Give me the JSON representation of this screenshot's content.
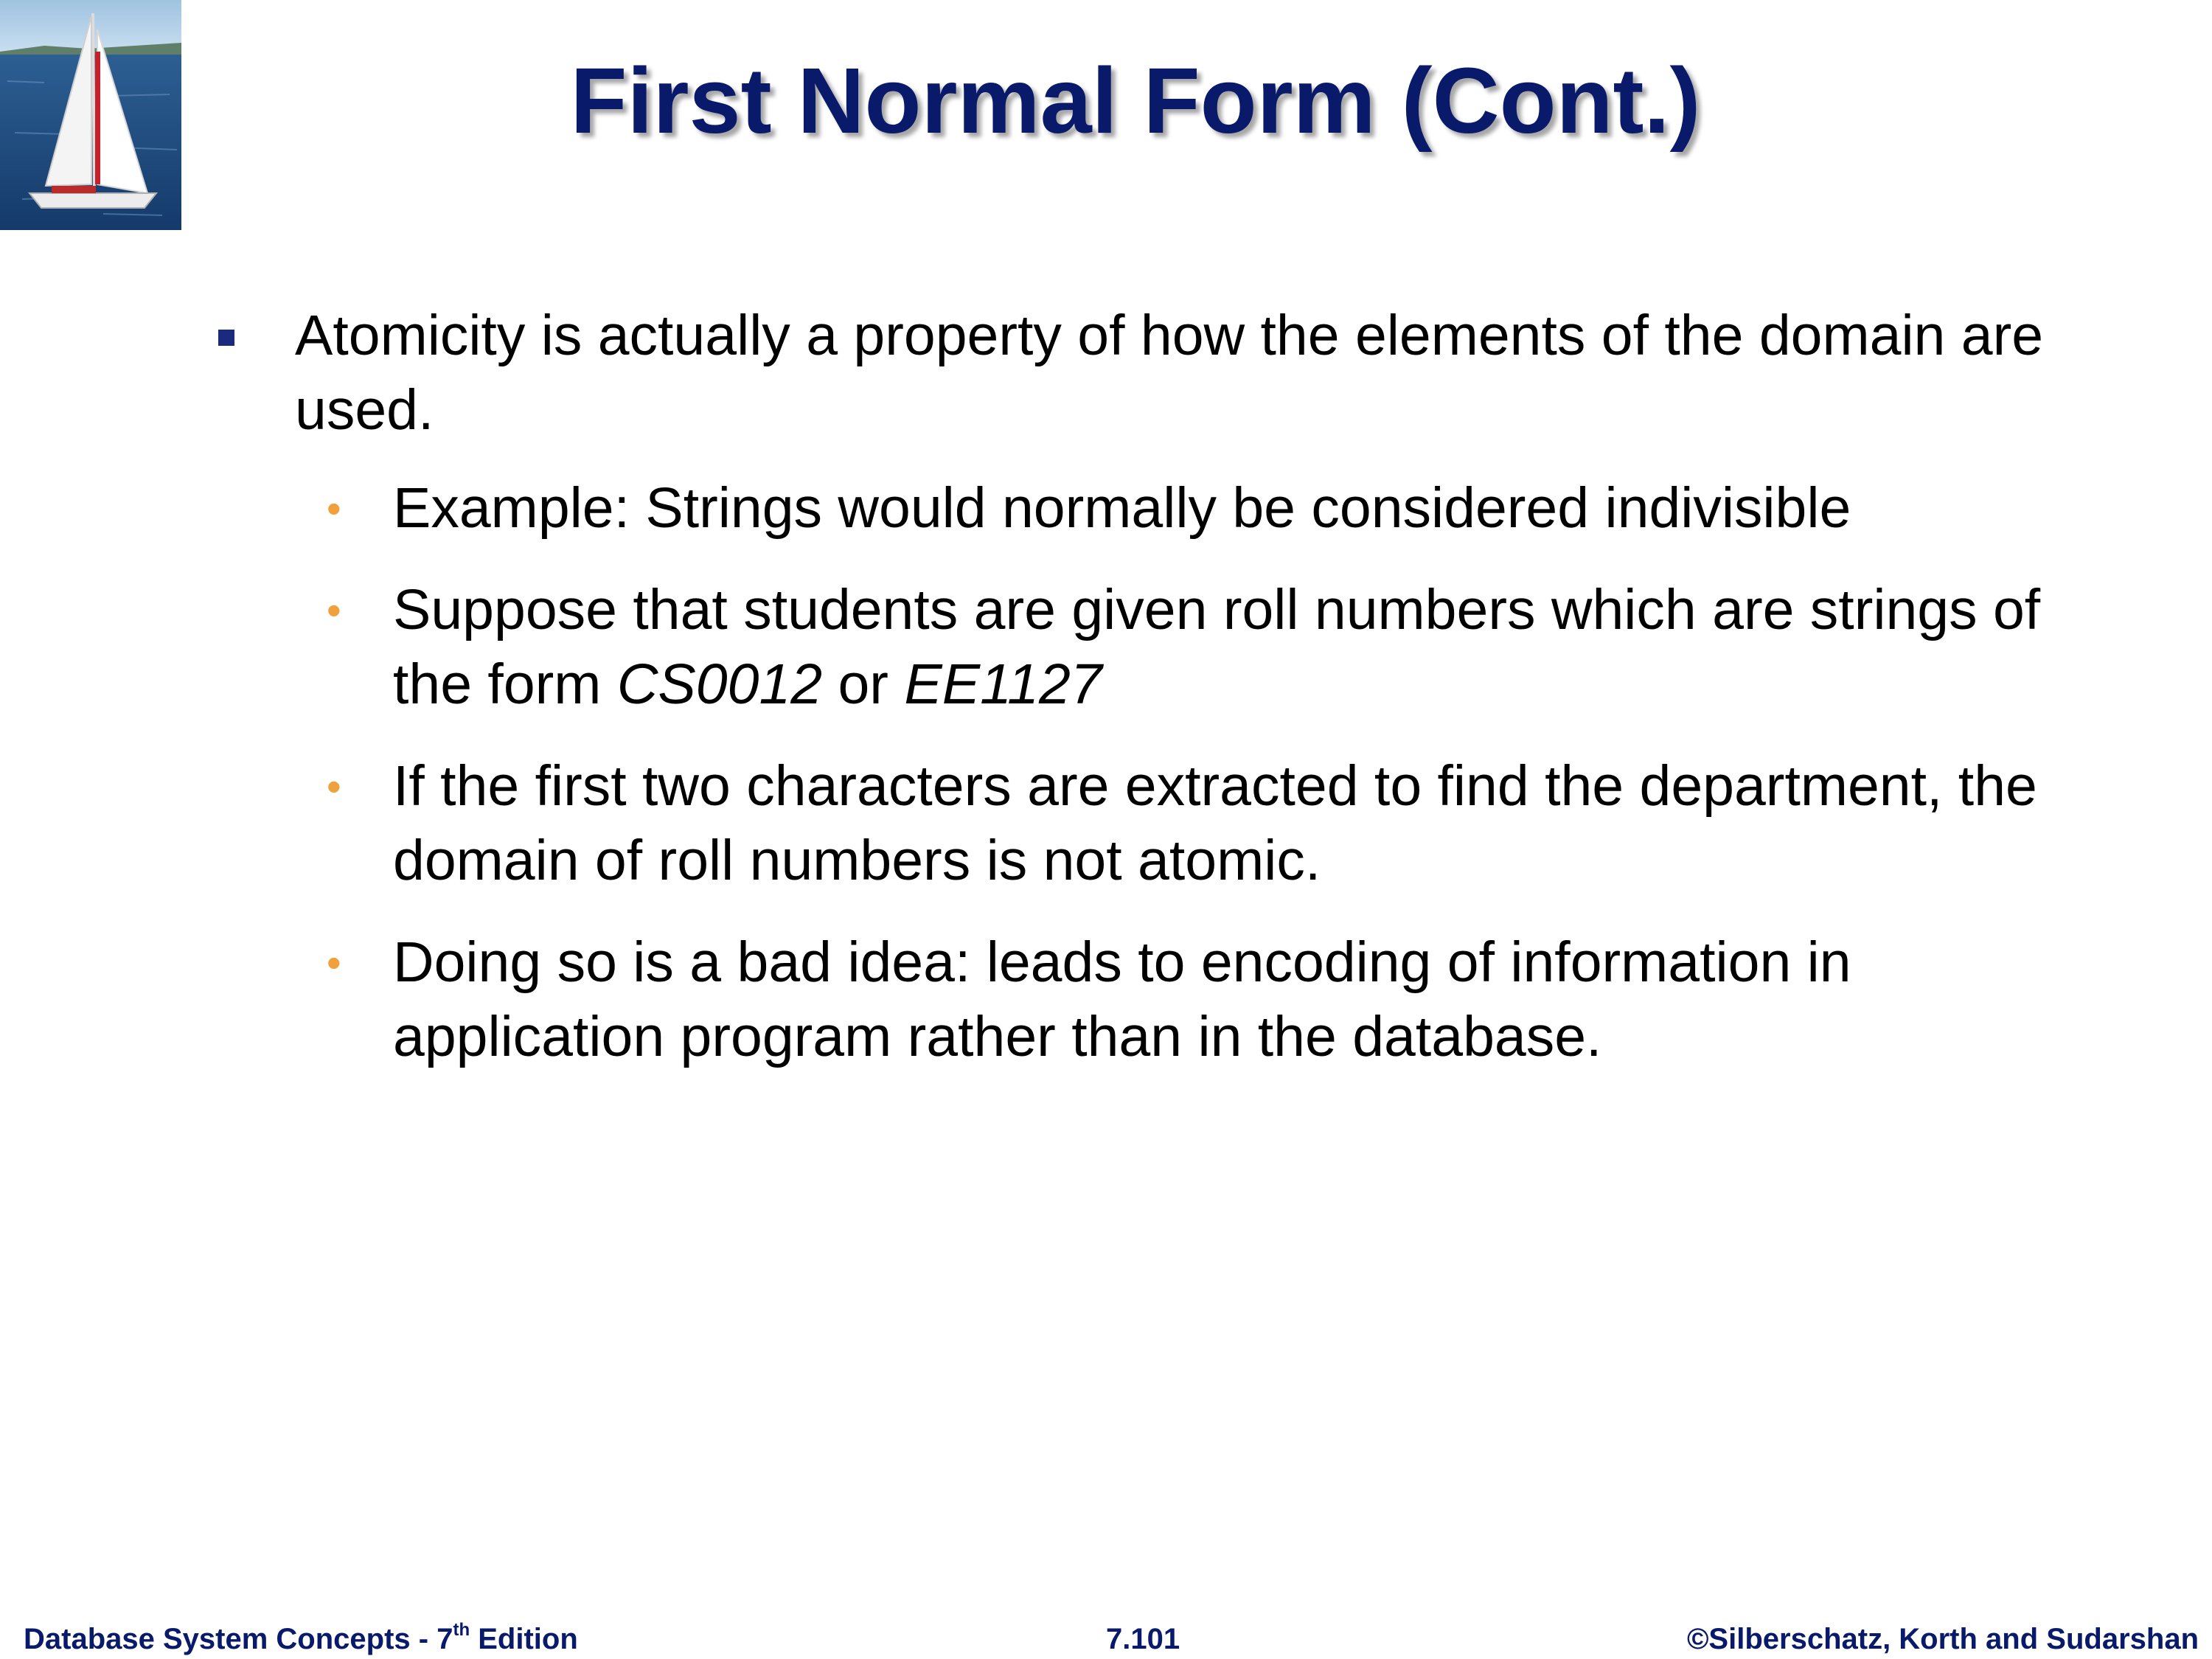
{
  "slide": {
    "title": "First Normal Form (Cont.)",
    "bullets": [
      {
        "text": "Atomicity is actually a property of how the elements of the domain are used.",
        "sub": [
          {
            "parts": [
              {
                "text": "Example: Strings would normally be considered indivisible",
                "italic": false
              }
            ]
          },
          {
            "parts": [
              {
                "text": "Suppose that students are given roll numbers which are strings of the form ",
                "italic": false
              },
              {
                "text": "CS0012",
                "italic": true
              },
              {
                "text": " or ",
                "italic": false
              },
              {
                "text": "EE1127",
                "italic": true
              }
            ]
          },
          {
            "parts": [
              {
                "text": "If the first two characters are extracted to find the department, the domain of roll numbers is not atomic.",
                "italic": false
              }
            ]
          },
          {
            "parts": [
              {
                "text": "Doing so is a bad idea: leads to encoding of information in application program rather than in the database.",
                "italic": false
              }
            ]
          }
        ]
      }
    ]
  },
  "footer": {
    "book_title": "Database System Concepts - 7",
    "edition_sup": "th",
    "edition_word": " Edition",
    "page_number": "7.101",
    "copyright": "©Silberschatz, Korth and Sudarshan"
  },
  "colors": {
    "title": "#0a1a6b",
    "level1_bullet": "#1b2a7e",
    "level2_bullet": "#f0a03c",
    "footer_text": "#0a1a6b"
  },
  "icons": {
    "level1_bullet": "square-bullet-icon",
    "level2_bullet": "round-bullet-icon",
    "corner_image": "sailboat-photo"
  }
}
